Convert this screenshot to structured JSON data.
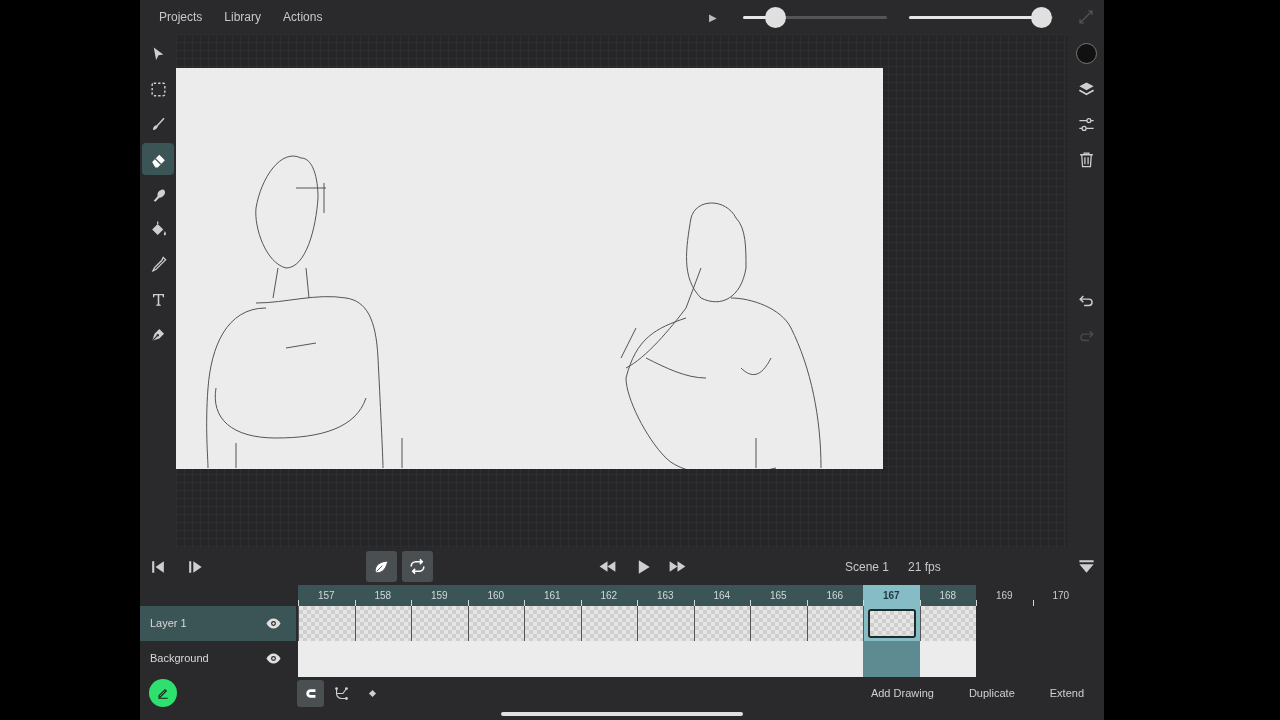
{
  "menu": [
    "Projects",
    "Library",
    "Actions"
  ],
  "top_controls": {
    "preview_play": "▶",
    "sliders": [
      {
        "level": 0.22
      },
      {
        "level": 0.92
      }
    ]
  },
  "tools": [
    {
      "kind": "select",
      "selected": false
    },
    {
      "kind": "marquee",
      "selected": false
    },
    {
      "kind": "brush",
      "selected": false
    },
    {
      "kind": "eraser",
      "selected": true
    },
    {
      "kind": "smudge",
      "selected": false
    },
    {
      "kind": "fill",
      "selected": false
    },
    {
      "kind": "eyedropper",
      "selected": false
    },
    {
      "kind": "text",
      "selected": false
    },
    {
      "kind": "pen",
      "selected": false
    }
  ],
  "right_tools": {
    "current_color": {
      "color": "#111111"
    },
    "actions": [
      {
        "kind": "layers"
      },
      {
        "kind": "adjust"
      },
      {
        "kind": "trash"
      }
    ],
    "history": [
      {
        "kind": "undo",
        "disabled": false
      },
      {
        "kind": "redo",
        "disabled": true
      }
    ]
  },
  "playback": {
    "onion_skin": {
      "on": true
    },
    "loop": {
      "on": true
    },
    "scene": "Scene 1",
    "fps": "21 fps"
  },
  "frames": [
    {
      "label": "157",
      "exposed": true,
      "selected": false
    },
    {
      "label": "158",
      "exposed": true,
      "selected": false
    },
    {
      "label": "159",
      "exposed": true,
      "selected": false
    },
    {
      "label": "160",
      "exposed": true,
      "selected": false
    },
    {
      "label": "161",
      "exposed": true,
      "selected": false
    },
    {
      "label": "162",
      "exposed": true,
      "selected": false
    },
    {
      "label": "163",
      "exposed": true,
      "selected": false
    },
    {
      "label": "164",
      "exposed": true,
      "selected": false
    },
    {
      "label": "165",
      "exposed": true,
      "selected": false
    },
    {
      "label": "166",
      "exposed": true,
      "selected": false
    },
    {
      "label": "167",
      "exposed": true,
      "selected": true
    },
    {
      "label": "168",
      "exposed": true,
      "selected": false
    },
    {
      "label": "169",
      "exposed": false,
      "selected": false
    },
    {
      "label": "170",
      "exposed": false,
      "selected": false
    }
  ],
  "layers": [
    {
      "name": "Layer 1",
      "kind": "drawing",
      "visible": true,
      "selected": true
    },
    {
      "name": "Background",
      "kind": "background",
      "visible": true,
      "selected": false
    }
  ],
  "bottom_tools": [
    {
      "kind": "snap",
      "selected": true
    },
    {
      "kind": "path",
      "selected": false
    },
    {
      "kind": "keyframe",
      "selected": false
    }
  ],
  "bottom_actions": [
    "Add Drawing",
    "Duplicate",
    "Extend"
  ]
}
